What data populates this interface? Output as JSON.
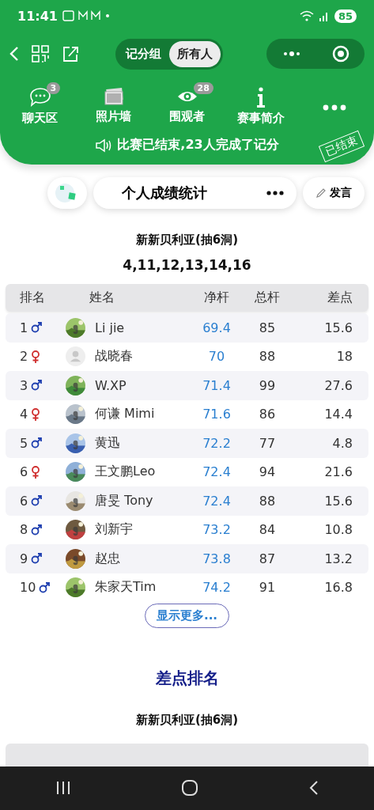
{
  "status_bar": {
    "time": "11:41",
    "battery": "85"
  },
  "nav": {
    "segments": [
      {
        "label": "记分组",
        "selected": false
      },
      {
        "label": "所有人",
        "selected": true
      }
    ]
  },
  "shortcuts": [
    {
      "kind": "chat",
      "label": "聊天区",
      "badge": "3"
    },
    {
      "kind": "photos",
      "label": "照片墙"
    },
    {
      "kind": "viewers",
      "label": "围观者",
      "badge": "28"
    },
    {
      "kind": "info",
      "label": "赛事简介"
    },
    {
      "kind": "more"
    }
  ],
  "notice": "比赛已结束,23人完成了记分",
  "stamp": "已结束",
  "toolbar": {
    "title": "个人成绩统计",
    "post_button": "发言"
  },
  "net_ranking": {
    "course": "新新贝利亚(抽6洞)",
    "holes": "4,11,12,13,14,16",
    "columns": [
      "排名",
      "姓名",
      "净杆",
      "总杆",
      "差点"
    ],
    "rows": [
      {
        "rank": "1",
        "female": false,
        "default_avatar": false,
        "name": "Li jie",
        "net": "69.4",
        "gross": "85",
        "handicap": "15.6"
      },
      {
        "rank": "2",
        "female": true,
        "default_avatar": true,
        "name": "战晓春",
        "net": "70",
        "gross": "88",
        "handicap": "18"
      },
      {
        "rank": "3",
        "female": false,
        "default_avatar": false,
        "name": "W.XP",
        "net": "71.4",
        "gross": "99",
        "handicap": "27.6"
      },
      {
        "rank": "4",
        "female": true,
        "default_avatar": false,
        "name": "何谦 Mimi",
        "net": "71.6",
        "gross": "86",
        "handicap": "14.4"
      },
      {
        "rank": "5",
        "female": false,
        "default_avatar": false,
        "name": "黄迅",
        "net": "72.2",
        "gross": "77",
        "handicap": "4.8"
      },
      {
        "rank": "6",
        "female": true,
        "default_avatar": false,
        "name": "王文鹏Leo",
        "net": "72.4",
        "gross": "94",
        "handicap": "21.6"
      },
      {
        "rank": "6",
        "female": false,
        "default_avatar": false,
        "name": "唐旻 Tony",
        "net": "72.4",
        "gross": "88",
        "handicap": "15.6"
      },
      {
        "rank": "8",
        "female": false,
        "default_avatar": false,
        "name": "刘新宇",
        "net": "73.2",
        "gross": "84",
        "handicap": "10.8"
      },
      {
        "rank": "9",
        "female": false,
        "default_avatar": false,
        "name": "赵忠",
        "net": "73.8",
        "gross": "87",
        "handicap": "13.2"
      },
      {
        "rank": "10",
        "female": false,
        "default_avatar": false,
        "name": "朱家天Tim",
        "net": "74.2",
        "gross": "91",
        "handicap": "16.8"
      }
    ],
    "show_more": "显示更多..."
  },
  "handicap_ranking": {
    "title": "差点排名",
    "course": "新新贝利亚(抽6洞)"
  }
}
